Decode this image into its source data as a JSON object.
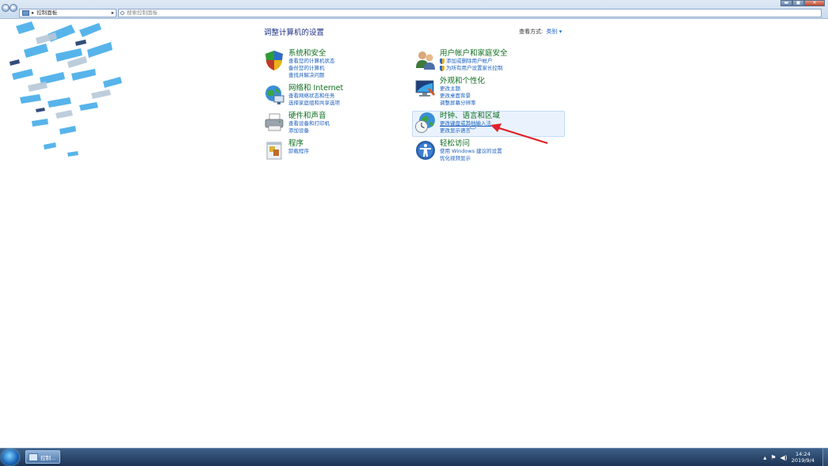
{
  "address_bar": {
    "breadcrumb_label": "控制面板",
    "search_placeholder": "搜索控制面板"
  },
  "window_buttons": {
    "minimize": "▬",
    "maximize": "▣",
    "close": "✕"
  },
  "main": {
    "title": "调整计算机的设置",
    "view_by_label": "查看方式:",
    "view_by_value": "类别 ▾"
  },
  "categories": [
    {
      "id": "system-security",
      "icon": "shield-icon",
      "title": "系统和安全",
      "links": [
        "查看您的计算机状态",
        "备份您的计算机",
        "查找并解决问题"
      ]
    },
    {
      "id": "network",
      "icon": "network-globe-icon",
      "title": "网络和 Internet",
      "links": [
        "查看网络状态和任务",
        "选择家庭组和共享选项"
      ]
    },
    {
      "id": "hardware",
      "icon": "printer-icon",
      "title": "硬件和声音",
      "links": [
        "查看设备和打印机",
        "添加设备"
      ]
    },
    {
      "id": "programs",
      "icon": "programs-icon",
      "title": "程序",
      "links": [
        "卸载程序"
      ]
    },
    {
      "id": "user-accounts",
      "icon": "users-icon",
      "title": "用户帐户和家庭安全",
      "links": [
        "添加或删除用户帐户",
        "为所有用户设置家长控制"
      ]
    },
    {
      "id": "appearance",
      "icon": "display-icon",
      "title": "外观和个性化",
      "links": [
        "更改主题",
        "更改桌面背景",
        "调整屏幕分辨率"
      ]
    },
    {
      "id": "clock-region",
      "icon": "clock-globe-icon",
      "title": "时钟、语言和区域",
      "links": [
        "更改键盘或其他输入法",
        "更改显示语言"
      ]
    },
    {
      "id": "ease-access",
      "icon": "ease-of-access-icon",
      "title": "轻松访问",
      "links": [
        "使用 Windows 建议的设置",
        "优化视频显示"
      ]
    }
  ],
  "taskbar": {
    "task_label": "控制...",
    "time": "14:24",
    "date": "2019/9/4"
  },
  "colors": {
    "accent_link": "#1a5fbf",
    "category_title": "#0e6e1e",
    "annotation_arrow": "#e0202a"
  }
}
